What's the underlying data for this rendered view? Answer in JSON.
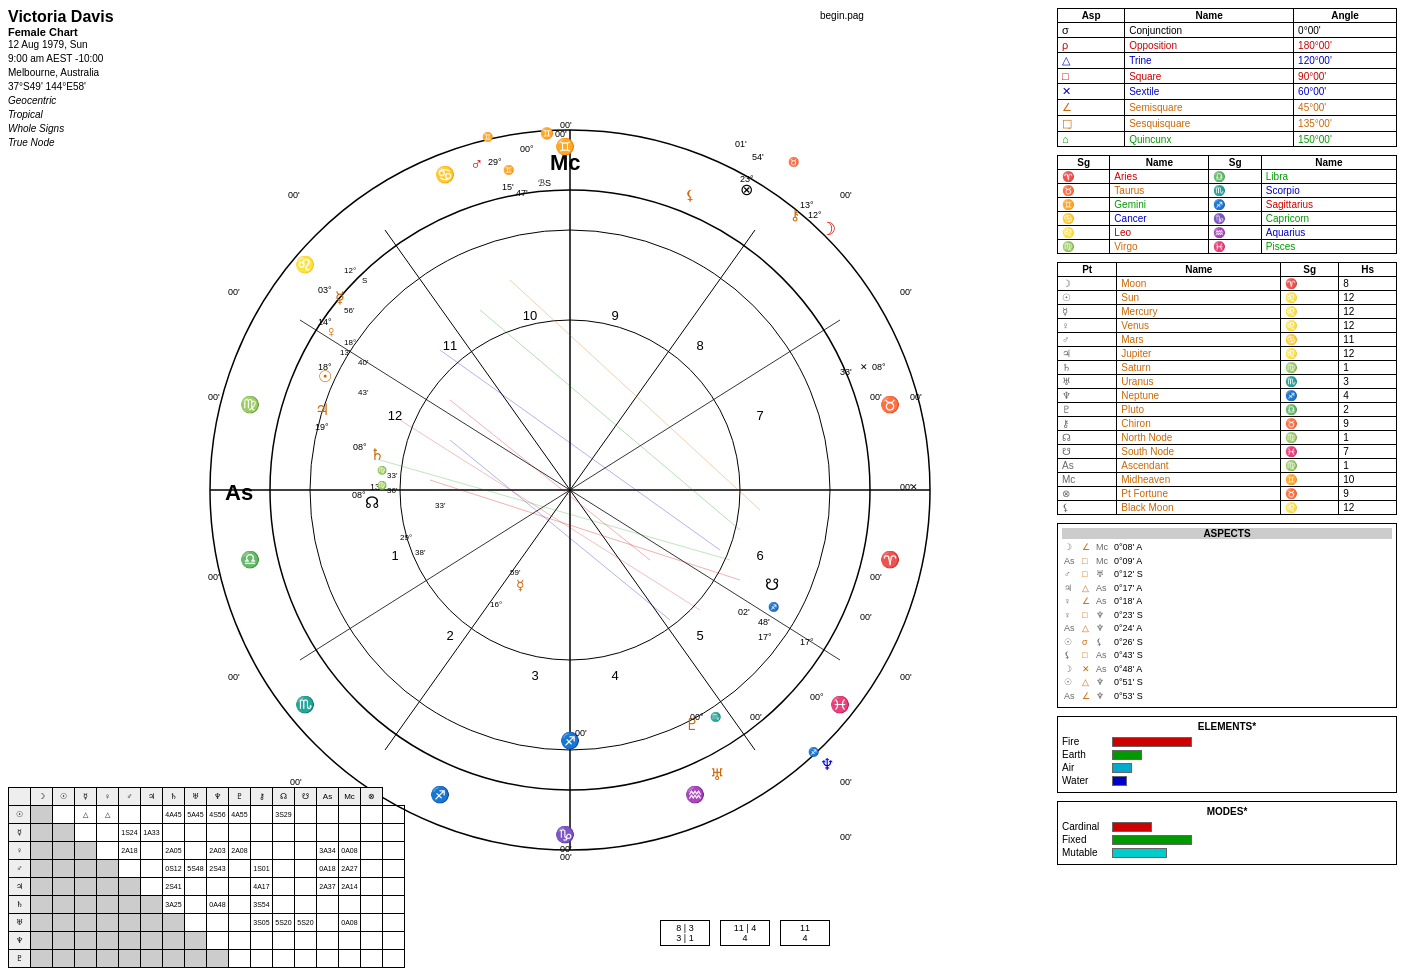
{
  "info": {
    "name": "Victoria Davis",
    "subtitle": "Female Chart",
    "date": "12 Aug 1979, Sun",
    "time": "9:00 am AEST -10:00",
    "location": "Melbourne, Australia",
    "coords": "37°S49' 144°E58'",
    "geocentric": "Geocentric",
    "tropical": "Tropical",
    "wholeSigns": "Whole Signs",
    "trueNode": "True Node"
  },
  "begin_pag": "begin.pag",
  "aspect_table": {
    "title": "Aspects",
    "headers": [
      "Asp",
      "Name",
      "Angle"
    ],
    "rows": [
      {
        "symbol": "σ",
        "name": "Conjunction",
        "angle": "0°00'",
        "color": "#000"
      },
      {
        "symbol": "ρ",
        "name": "Opposition",
        "angle": "180°00'",
        "color": "#cc0000"
      },
      {
        "symbol": "△",
        "name": "Trine",
        "angle": "120°00'",
        "color": "#0000cc"
      },
      {
        "symbol": "□",
        "name": "Square",
        "angle": "90°00'",
        "color": "#cc0000"
      },
      {
        "symbol": "✕",
        "name": "Sextile",
        "angle": "60°00'",
        "color": "#0000cc"
      },
      {
        "symbol": "∠",
        "name": "Semisquare",
        "angle": "45°00'",
        "color": "#cc6600"
      },
      {
        "symbol": "ϖ",
        "name": "Sesquisquare",
        "angle": "135°00'",
        "color": "#cc6600"
      },
      {
        "symbol": "⌂",
        "name": "Quincunx",
        "angle": "150°00'",
        "color": "#009900"
      }
    ]
  },
  "sign_table": {
    "headers_left": [
      "Sg",
      "Name"
    ],
    "headers_right": [
      "Sg",
      "Name"
    ],
    "rows": [
      {
        "sg1": "♈",
        "name1": "Aries",
        "c1": "aries",
        "sg2": "♎",
        "name2": "Libra",
        "c2": "libra"
      },
      {
        "sg1": "♉",
        "name1": "Taurus",
        "c1": "taurus",
        "sg2": "♏",
        "name2": "Scorpio",
        "c2": "scorpio"
      },
      {
        "sg1": "♊",
        "name1": "Gemini",
        "c1": "gemini",
        "sg2": "♐",
        "name2": "Sagittarius",
        "c2": "sagittarius"
      },
      {
        "sg1": "♋",
        "name1": "Cancer",
        "c1": "cancer",
        "sg2": "♑",
        "name2": "Capricorn",
        "c2": "capricorn"
      },
      {
        "sg1": "♌",
        "name1": "Leo",
        "c1": "leo",
        "sg2": "♒",
        "name2": "Aquarius",
        "c2": "aquarius"
      },
      {
        "sg1": "♍",
        "name1": "Virgo",
        "c1": "virgo",
        "sg2": "♓",
        "name2": "Pisces",
        "c2": "pisces"
      }
    ]
  },
  "planet_table": {
    "headers": [
      "Pt",
      "Name",
      "Sg",
      "Hs"
    ],
    "rows": [
      {
        "symbol": "☽",
        "name": "Moon",
        "sg": "♈",
        "hs": "8"
      },
      {
        "symbol": "☉",
        "name": "Sun",
        "sg": "♌",
        "hs": "12"
      },
      {
        "symbol": "☿",
        "name": "Mercury",
        "sg": "♌",
        "hs": "12"
      },
      {
        "symbol": "♀",
        "name": "Venus",
        "sg": "♌",
        "hs": "12"
      },
      {
        "symbol": "♂",
        "name": "Mars",
        "sg": "♋",
        "hs": "11"
      },
      {
        "symbol": "♃",
        "name": "Jupiter",
        "sg": "♌",
        "hs": "12"
      },
      {
        "symbol": "♄",
        "name": "Saturn",
        "sg": "♍",
        "hs": "1"
      },
      {
        "symbol": "♅",
        "name": "Uranus",
        "sg": "♏",
        "hs": "3"
      },
      {
        "symbol": "♆",
        "name": "Neptune",
        "sg": "♐",
        "hs": "4"
      },
      {
        "symbol": "♇",
        "name": "Pluto",
        "sg": "♎",
        "hs": "2"
      },
      {
        "symbol": "⚷",
        "name": "Chiron",
        "sg": "♉",
        "hs": "9"
      },
      {
        "symbol": "☊",
        "name": "North Node",
        "sg": "♍",
        "hs": "1"
      },
      {
        "symbol": "☋",
        "name": "South Node",
        "sg": "♓",
        "hs": "7"
      },
      {
        "symbol": "As",
        "name": "Ascendant",
        "sg": "♍",
        "hs": "1"
      },
      {
        "symbol": "Mc",
        "name": "Midheaven",
        "sg": "♊",
        "hs": "10"
      },
      {
        "symbol": "⊗",
        "name": "Pt Fortune",
        "sg": "♉",
        "hs": "9"
      },
      {
        "symbol": "⚸",
        "name": "Black Moon",
        "sg": "♌",
        "hs": "12"
      }
    ]
  },
  "elements": {
    "title": "ELEMENTS*",
    "rows": [
      {
        "label": "Fire",
        "color": "#cc0000",
        "width": 80
      },
      {
        "label": "Earth",
        "color": "#009900",
        "width": 30
      },
      {
        "label": "Air",
        "color": "#00aacc",
        "width": 20
      },
      {
        "label": "Water",
        "color": "#0000cc",
        "width": 15
      }
    ]
  },
  "modes": {
    "title": "MODES*",
    "rows": [
      {
        "label": "Cardinal",
        "color": "#cc0000",
        "width": 40
      },
      {
        "label": "Fixed",
        "color": "#009900",
        "width": 80
      },
      {
        "label": "Mutable",
        "color": "#00cccc",
        "width": 55
      }
    ]
  },
  "aspects_small": {
    "title": "ASPECTS",
    "rows": [
      {
        "p1": "☽",
        "asp": "∠",
        "p2": "Mc",
        "val": "0°08' A"
      },
      {
        "p1": "As",
        "asp": "□",
        "p2": "Mc",
        "val": "0°09' A"
      },
      {
        "p1": "♂",
        "asp": "□",
        "p2": "♅",
        "val": "0°12' S"
      },
      {
        "p1": "♃",
        "asp": "△",
        "p2": "As",
        "val": "0°17' A"
      },
      {
        "p1": "♀",
        "asp": "∠",
        "p2": "As",
        "val": "0°18' A"
      },
      {
        "p1": "♀",
        "asp": "□",
        "p2": "♆",
        "val": "0°23' S"
      },
      {
        "p1": "As",
        "asp": "△",
        "p2": "♆",
        "val": "0°24' A"
      },
      {
        "p1": "☉",
        "asp": "σ",
        "p2": "⚸",
        "val": "0°26' S"
      },
      {
        "p1": "⚸",
        "asp": "□",
        "p2": "As",
        "val": "0°43' S"
      },
      {
        "p1": "☽",
        "asp": "×",
        "p2": "As",
        "val": "0°48' A"
      },
      {
        "p1": "☉",
        "asp": "△",
        "p2": "♆",
        "val": "0°51' S"
      },
      {
        "p1": "As",
        "asp": "∠",
        "p2": "♆",
        "val": "0°53' S"
      }
    ]
  },
  "bottom_counts": {
    "left": {
      "top": "8",
      "mid": "3",
      "bot": "3",
      "bot2": "1"
    },
    "right": {
      "top": "11",
      "mid": "4",
      "bot": "4"
    }
  }
}
